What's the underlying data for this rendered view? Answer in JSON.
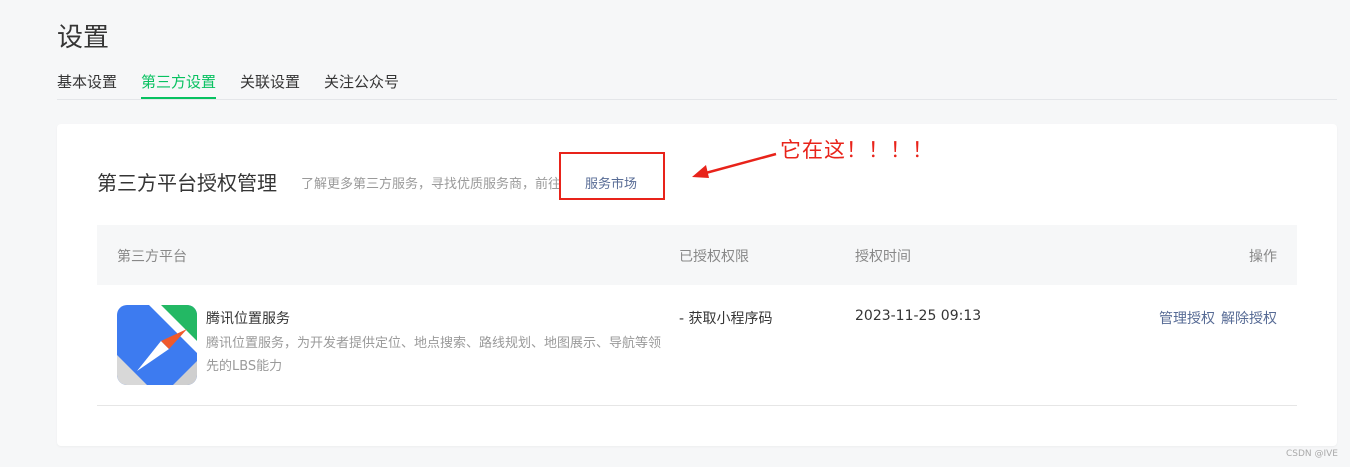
{
  "page": {
    "title": "设置"
  },
  "tabs": [
    {
      "label": "基本设置",
      "active": false
    },
    {
      "label": "第三方设置",
      "active": true
    },
    {
      "label": "关联设置",
      "active": false
    },
    {
      "label": "关注公众号",
      "active": false
    }
  ],
  "section": {
    "title": "第三方平台授权管理",
    "description": "了解更多第三方服务，寻找优质服务商，前往",
    "market_link": "服务市场"
  },
  "table": {
    "headers": {
      "platform": "第三方平台",
      "permissions": "已授权权限",
      "auth_time": "授权时间",
      "actions": "操作"
    },
    "rows": [
      {
        "name": "腾讯位置服务",
        "description": "腾讯位置服务，为开发者提供定位、地点搜索、路线规划、地图展示、导航等领先的LBS能力",
        "permission": "- 获取小程序码",
        "time": "2023-11-25 09:13",
        "action_manage": "管理授权",
        "action_revoke": "解除授权"
      }
    ]
  },
  "annotation": {
    "text": "它在这！！！！"
  },
  "watermark": "CSDN @IVE",
  "colors": {
    "accent": "#07c160",
    "link": "#576b95",
    "annotation": "#e8231a"
  },
  "icons": {
    "app_logo": "tencent-map-icon"
  }
}
